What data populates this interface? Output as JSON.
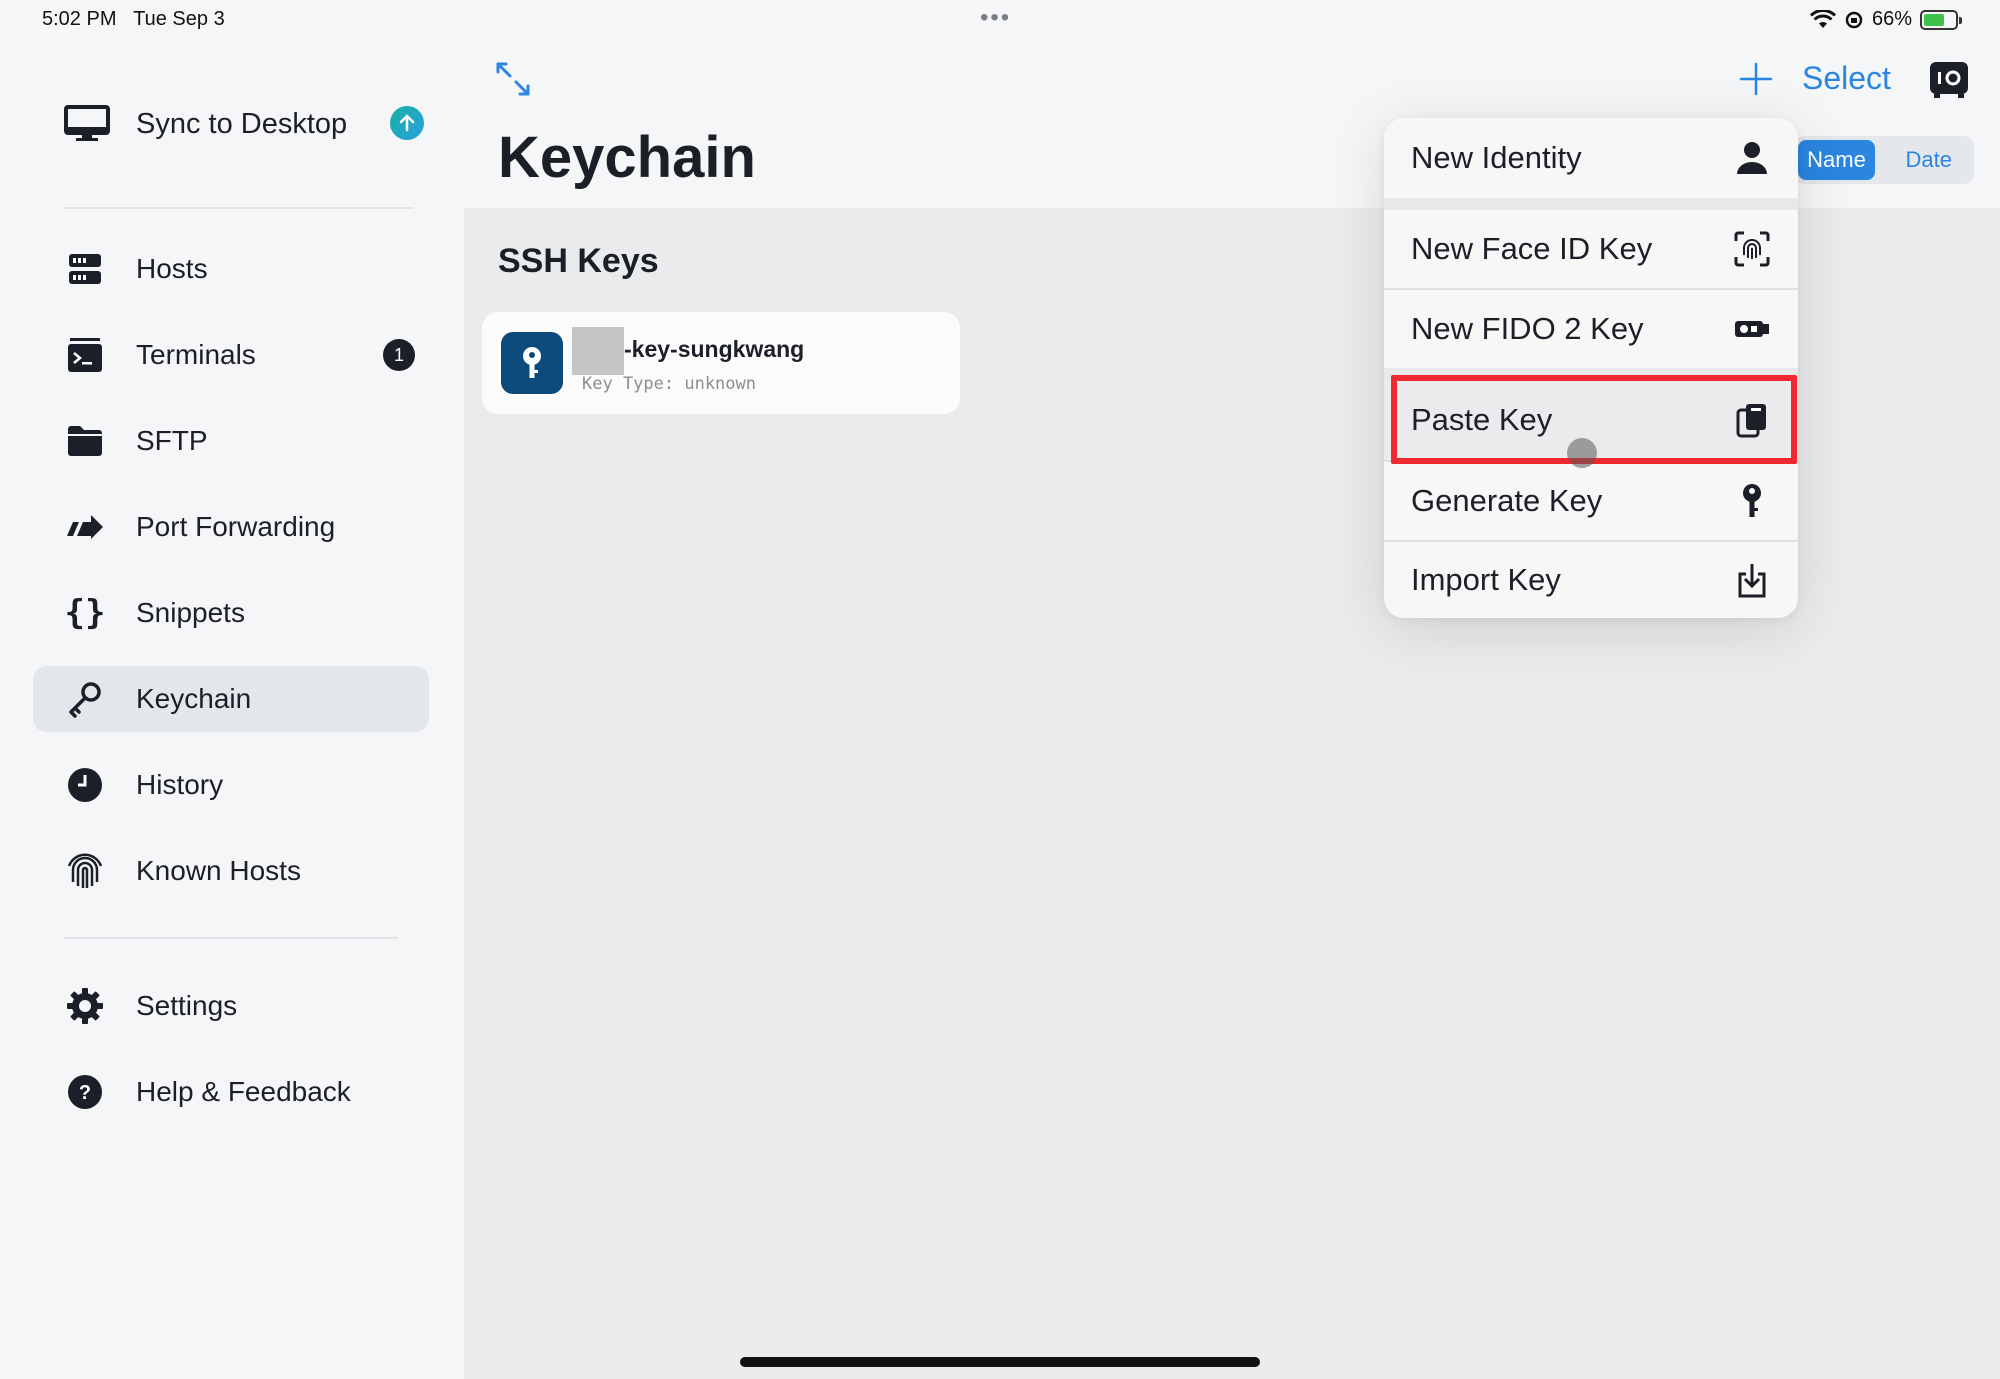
{
  "status": {
    "time": "5:02 PM",
    "date": "Tue Sep 3",
    "dots": "•••",
    "battery": "66%",
    "battery_level": 0.66
  },
  "sidebar": {
    "sync_label": "Sync to Desktop",
    "items": [
      {
        "label": "Hosts",
        "icon": "server-icon"
      },
      {
        "label": "Terminals",
        "icon": "terminal-icon",
        "badge": "1"
      },
      {
        "label": "SFTP",
        "icon": "folder-icon"
      },
      {
        "label": "Port Forwarding",
        "icon": "port-forward-icon"
      },
      {
        "label": "Snippets",
        "icon": "braces-icon"
      },
      {
        "label": "Keychain",
        "icon": "key-icon",
        "active": true
      },
      {
        "label": "History",
        "icon": "clock-icon"
      },
      {
        "label": "Known Hosts",
        "icon": "fingerprint-icon"
      }
    ],
    "footer_items": [
      {
        "label": "Settings",
        "icon": "gear-icon"
      },
      {
        "label": "Help & Feedback",
        "icon": "help-icon"
      }
    ]
  },
  "header": {
    "title": "Keychain",
    "select_label": "Select"
  },
  "sort": {
    "options": [
      "Name",
      "Date"
    ],
    "selected": "Name"
  },
  "content": {
    "section_title": "SSH Keys",
    "key": {
      "name": "-key-sungkwang",
      "type": "Key Type: unknown"
    }
  },
  "menu": {
    "items": [
      {
        "label": "New Identity",
        "icon": "person-icon"
      },
      {
        "label": "New Face ID Key",
        "icon": "faceid-icon"
      },
      {
        "label": "New FIDO 2 Key",
        "icon": "security-key-icon"
      },
      {
        "label": "Paste Key",
        "icon": "clipboard-icon",
        "highlighted": true
      },
      {
        "label": "Generate Key",
        "icon": "key-icon"
      },
      {
        "label": "Import Key",
        "icon": "import-icon"
      }
    ]
  },
  "colors": {
    "accent": "#2a86e0",
    "highlight": "#f0282f",
    "key_avatar": "#0d4a7c"
  }
}
